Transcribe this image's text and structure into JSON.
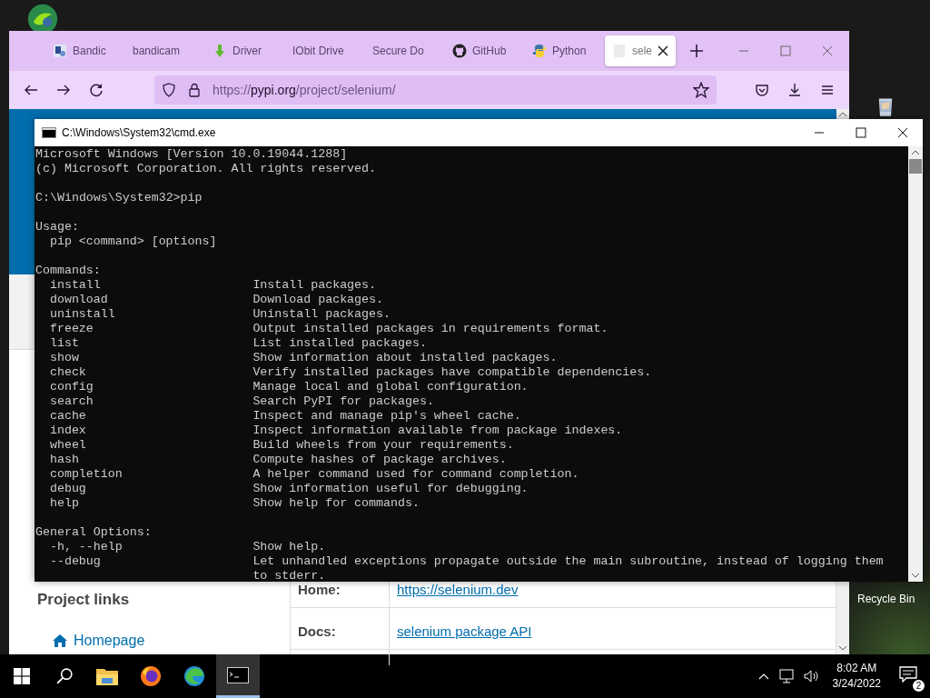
{
  "desktop_icons": [
    {
      "label": "Recycle Bin"
    }
  ],
  "browser": {
    "tabs": [
      {
        "label": "Bandic",
        "kind": "app",
        "selected": false
      },
      {
        "label": "bandicam",
        "kind": "plain",
        "selected": false
      },
      {
        "label": "Driver",
        "kind": "download",
        "selected": false
      },
      {
        "label": "IObit Drive",
        "kind": "plain",
        "selected": false
      },
      {
        "label": "Secure Do",
        "kind": "plain",
        "selected": false
      },
      {
        "label": "GitHub",
        "kind": "github",
        "selected": false
      },
      {
        "label": "Python",
        "kind": "python",
        "selected": false
      },
      {
        "label": "sele",
        "kind": "page",
        "selected": true
      }
    ],
    "url": {
      "scheme": "https://",
      "host": "pypi.org",
      "path": "/project/selenium/"
    },
    "page": {
      "sidebar_heading": "Project links",
      "sidebar_links": [
        {
          "label": "Homepage"
        }
      ],
      "links_table": [
        {
          "label": "Home:",
          "value": "https://selenium.dev"
        },
        {
          "label": "Docs:",
          "value": "selenium package API"
        }
      ]
    }
  },
  "console": {
    "title": "C:\\Windows\\System32\\cmd.exe",
    "banner": [
      "Microsoft Windows [Version 10.0.19044.1288]",
      "(c) Microsoft Corporation. All rights reserved."
    ],
    "prompt": "C:\\Windows\\System32>pip",
    "usage_heading": "Usage:",
    "usage": "pip <command> [options]",
    "commands_heading": "Commands:",
    "commands": [
      {
        "name": "install",
        "description": "Install packages."
      },
      {
        "name": "download",
        "description": "Download packages."
      },
      {
        "name": "uninstall",
        "description": "Uninstall packages."
      },
      {
        "name": "freeze",
        "description": "Output installed packages in requirements format."
      },
      {
        "name": "list",
        "description": "List installed packages."
      },
      {
        "name": "show",
        "description": "Show information about installed packages."
      },
      {
        "name": "check",
        "description": "Verify installed packages have compatible dependencies."
      },
      {
        "name": "config",
        "description": "Manage local and global configuration."
      },
      {
        "name": "search",
        "description": "Search PyPI for packages."
      },
      {
        "name": "cache",
        "description": "Inspect and manage pip's wheel cache."
      },
      {
        "name": "index",
        "description": "Inspect information available from package indexes."
      },
      {
        "name": "wheel",
        "description": "Build wheels from your requirements."
      },
      {
        "name": "hash",
        "description": "Compute hashes of package archives."
      },
      {
        "name": "completion",
        "description": "A helper command used for command completion."
      },
      {
        "name": "debug",
        "description": "Show information useful for debugging."
      },
      {
        "name": "help",
        "description": "Show help for commands."
      }
    ],
    "options_heading": "General Options:",
    "options": [
      {
        "name": "-h, --help",
        "description": "Show help."
      },
      {
        "name": "--debug",
        "description": "Let unhandled exceptions propagate outside the main subroutine, instead of logging them to stderr."
      }
    ]
  },
  "taskbar": {
    "apps": [
      {
        "kind": "explorer",
        "selected": false
      },
      {
        "kind": "firefox",
        "selected": false
      },
      {
        "kind": "edge",
        "selected": false
      },
      {
        "kind": "cmd",
        "selected": true
      }
    ],
    "time": "8:02 AM",
    "date": "3/24/2022",
    "notifications": "2"
  }
}
